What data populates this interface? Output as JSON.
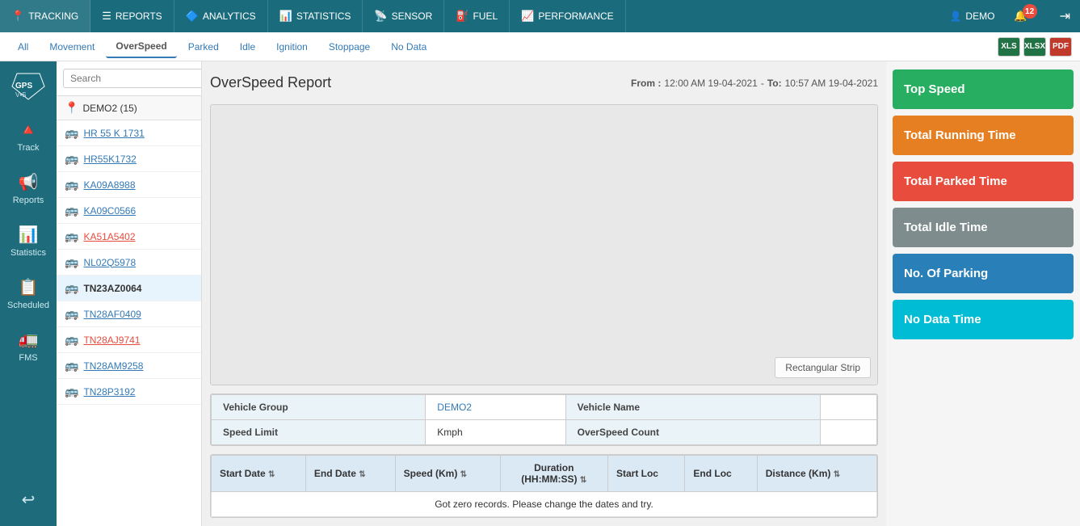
{
  "topNav": {
    "items": [
      {
        "id": "tracking",
        "label": "TRACKING",
        "icon": "📍"
      },
      {
        "id": "reports",
        "label": "REPORTS",
        "icon": "📋"
      },
      {
        "id": "analytics",
        "label": "ANALYTICS",
        "icon": "🔷"
      },
      {
        "id": "statistics",
        "label": "STATISTICS",
        "icon": "📊"
      },
      {
        "id": "sensor",
        "label": "SENSOR",
        "icon": "📡"
      },
      {
        "id": "fuel",
        "label": "FUEL",
        "icon": "⛽"
      },
      {
        "id": "performance",
        "label": "PERFORMANCE",
        "icon": "📈"
      }
    ],
    "user": "DEMO",
    "notifCount": "12",
    "logoutIcon": "→"
  },
  "subNav": {
    "tabs": [
      {
        "id": "all",
        "label": "All"
      },
      {
        "id": "movement",
        "label": "Movement"
      },
      {
        "id": "overspeed",
        "label": "OverSpeed",
        "active": true
      },
      {
        "id": "parked",
        "label": "Parked"
      },
      {
        "id": "idle",
        "label": "Idle"
      },
      {
        "id": "ignition",
        "label": "Ignition"
      },
      {
        "id": "stoppage",
        "label": "Stoppage"
      },
      {
        "id": "nodata",
        "label": "No Data"
      }
    ],
    "exports": [
      {
        "id": "excel1",
        "icon": "📗",
        "label": "XLS"
      },
      {
        "id": "excel2",
        "icon": "📗",
        "label": "XLSX"
      },
      {
        "id": "pdf",
        "icon": "📕",
        "label": "PDF"
      }
    ]
  },
  "sidebar": {
    "logo": "GPS",
    "items": [
      {
        "id": "track",
        "label": "Track",
        "icon": "🔺"
      },
      {
        "id": "reports",
        "label": "Reports",
        "icon": "📢"
      },
      {
        "id": "statistics",
        "label": "Statistics",
        "icon": "📊"
      },
      {
        "id": "scheduled",
        "label": "Scheduled",
        "icon": "📋"
      },
      {
        "id": "fms",
        "label": "FMS",
        "icon": "🚛"
      },
      {
        "id": "logout",
        "label": "",
        "icon": "↩"
      }
    ]
  },
  "vehiclePanel": {
    "searchPlaceholder": "Search",
    "groupLabel": "DEMO2 (15)",
    "vehicles": [
      {
        "id": "v1",
        "plate": "HR 55 K 1731",
        "iconColor": "gray",
        "linkColor": "blue"
      },
      {
        "id": "v2",
        "plate": "HR55K1732",
        "iconColor": "gray",
        "linkColor": "blue"
      },
      {
        "id": "v3",
        "plate": "KA09A8988",
        "iconColor": "gray",
        "linkColor": "blue"
      },
      {
        "id": "v4",
        "plate": "KA09C0566",
        "iconColor": "gray",
        "linkColor": "blue"
      },
      {
        "id": "v5",
        "plate": "KA51A5402",
        "iconColor": "red",
        "linkColor": "red"
      },
      {
        "id": "v6",
        "plate": "NL02Q5978",
        "iconColor": "gray",
        "linkColor": "blue"
      },
      {
        "id": "v7",
        "plate": "TN23AZ0064",
        "iconColor": "red",
        "linkColor": "active",
        "active": true
      },
      {
        "id": "v8",
        "plate": "TN28AF0409",
        "iconColor": "gray",
        "linkColor": "blue"
      },
      {
        "id": "v9",
        "plate": "TN28AJ9741",
        "iconColor": "red",
        "linkColor": "red"
      },
      {
        "id": "v10",
        "plate": "TN28AM9258",
        "iconColor": "gray",
        "linkColor": "blue"
      },
      {
        "id": "v11",
        "plate": "TN28P3192",
        "iconColor": "gray",
        "linkColor": "blue"
      }
    ]
  },
  "report": {
    "title": "OverSpeed Report",
    "fromLabel": "From :",
    "fromDate": "12:00 AM  19-04-2021",
    "toLabel": "To:",
    "toDate": "10:57 AM  19-04-2021",
    "dash": "-",
    "mapButtonLabel": "Rectangular Strip",
    "infoTable": {
      "rows": [
        {
          "label1": "Vehicle Group",
          "value1": "DEMO2",
          "label2": "Vehicle Name",
          "value2": ""
        },
        {
          "label1": "Speed Limit",
          "value1": "Kmph",
          "label2": "OverSpeed Count",
          "value2": ""
        }
      ]
    },
    "dataTable": {
      "columns": [
        {
          "id": "startDate",
          "label": "Start Date",
          "sortable": true
        },
        {
          "id": "endDate",
          "label": "End Date",
          "sortable": true
        },
        {
          "id": "speed",
          "label": "Speed (Km)",
          "sortable": true
        },
        {
          "id": "duration",
          "label": "Duration\n(HH:MM:SS)",
          "sortable": true
        },
        {
          "id": "startLoc",
          "label": "Start Loc",
          "sortable": false
        },
        {
          "id": "endLoc",
          "label": "End Loc",
          "sortable": false
        },
        {
          "id": "distance",
          "label": "Distance (Km)",
          "sortable": true
        }
      ],
      "emptyMessage": "Got zero records. Please change the dates and try."
    }
  },
  "statsPanel": {
    "cards": [
      {
        "id": "topSpeed",
        "label": "Top Speed",
        "color": "green"
      },
      {
        "id": "totalRunning",
        "label": "Total Running Time",
        "color": "orange"
      },
      {
        "id": "totalParked",
        "label": "Total Parked Time",
        "color": "red"
      },
      {
        "id": "totalIdle",
        "label": "Total Idle Time",
        "color": "gray"
      },
      {
        "id": "noOfParking",
        "label": "No. Of Parking",
        "color": "blue"
      },
      {
        "id": "noDataTime",
        "label": "No Data Time",
        "color": "cyan"
      }
    ]
  }
}
